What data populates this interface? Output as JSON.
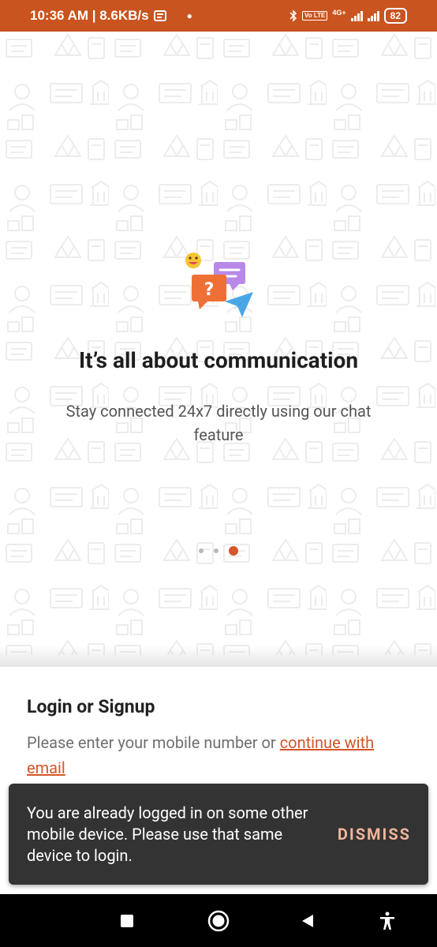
{
  "status_bar": {
    "time_speed": "10:36 AM | 8.6KB/s",
    "network_label": "4G+",
    "volte_label": "Vo LTE",
    "battery": "82"
  },
  "onboarding": {
    "title": "It’s all about communication",
    "subtitle": "Stay connected 24x7 directly using our chat feature",
    "page_count": 3,
    "active_page": 3
  },
  "login": {
    "title": "Login or Signup",
    "prompt": "Please enter your mobile number or ",
    "email_link": "continue with email"
  },
  "snackbar": {
    "message": "You are already logged in on some other mobile device. Please use that same device to login.",
    "action": "DISMISS"
  },
  "colors": {
    "accent": "#d4562a",
    "status_bar": "#c9541f",
    "snackbar_bg": "#333333",
    "snackbar_action": "#f2b49a"
  },
  "nav_icons": [
    "recent-apps-icon",
    "home-icon",
    "back-icon",
    "accessibility-icon"
  ]
}
